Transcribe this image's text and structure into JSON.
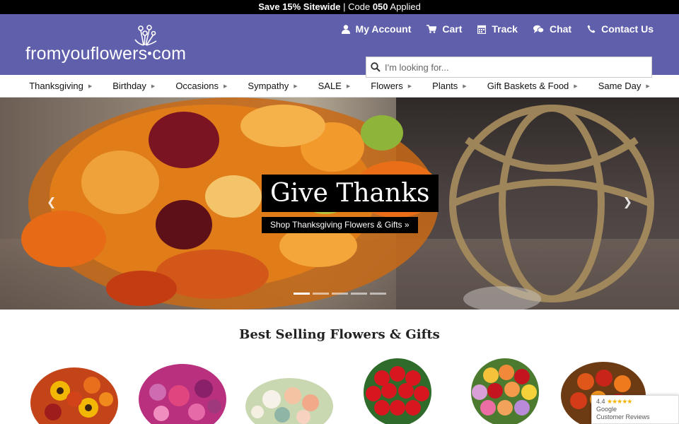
{
  "promo": {
    "save_text": "Save 15% Sitewide",
    "separator": " | Code ",
    "code": "050",
    "applied": " Applied"
  },
  "header": {
    "logo_text_left": "fromyouflowers",
    "logo_text_right": "com",
    "utility": [
      {
        "label": "My Account",
        "icon": "user-icon"
      },
      {
        "label": "Cart",
        "icon": "cart-icon"
      },
      {
        "label": "Track",
        "icon": "calendar-icon"
      },
      {
        "label": "Chat",
        "icon": "chat-icon"
      },
      {
        "label": "Contact Us",
        "icon": "phone-icon"
      }
    ],
    "search_placeholder": "I'm looking for..."
  },
  "nav": [
    "Thanksgiving",
    "Birthday",
    "Occasions",
    "Sympathy",
    "SALE",
    "Flowers",
    "Plants",
    "Gift Baskets & Food",
    "Same Day"
  ],
  "hero": {
    "title": "Give Thanks",
    "subtitle": "Shop Thanksgiving Flowers & Gifts »",
    "slides": 5,
    "active_slide": 1
  },
  "best_selling": {
    "title": "Best Selling Flowers & Gifts"
  },
  "google_review": {
    "rating": "4.4",
    "stars": "★★★★★",
    "line1": "Google",
    "line2": "Customer Reviews"
  },
  "colors": {
    "header_bg": "#5f5fac",
    "promo_bg": "#000000"
  }
}
